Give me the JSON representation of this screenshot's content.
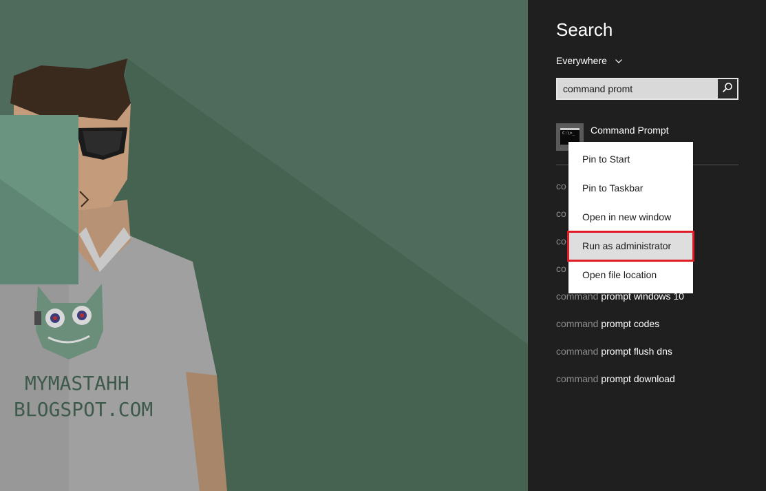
{
  "watermark": {
    "line1": "MYMASTAHH",
    "line2": "BLOGSPOT.COM"
  },
  "search": {
    "title": "Search",
    "scope": "Everywhere",
    "query": "command promt"
  },
  "top_result": {
    "label": "Command Prompt",
    "icon": "command-prompt-icon",
    "icon_text": "C:\\>_"
  },
  "context_menu": {
    "items": [
      {
        "label": "Pin to Start"
      },
      {
        "label": "Pin to Taskbar"
      },
      {
        "label": "Open in new window"
      },
      {
        "label": "Run as administrator",
        "highlighted": true
      },
      {
        "label": "Open file location"
      }
    ]
  },
  "suggestions": [
    {
      "query": "co",
      "rest": ""
    },
    {
      "query": "co",
      "rest": ""
    },
    {
      "query": "co",
      "rest": ""
    },
    {
      "query": "co",
      "rest": ""
    },
    {
      "query": "command",
      "rest": " prompt windows 10"
    },
    {
      "query": "command",
      "rest": " prompt codes"
    },
    {
      "query": "command",
      "rest": " prompt flush dns"
    },
    {
      "query": "command",
      "rest": " prompt download"
    }
  ],
  "colors": {
    "panel_bg": "#1f1f1f",
    "wallpaper_bg": "#4e6b5b",
    "highlight_border": "#e11b24"
  }
}
